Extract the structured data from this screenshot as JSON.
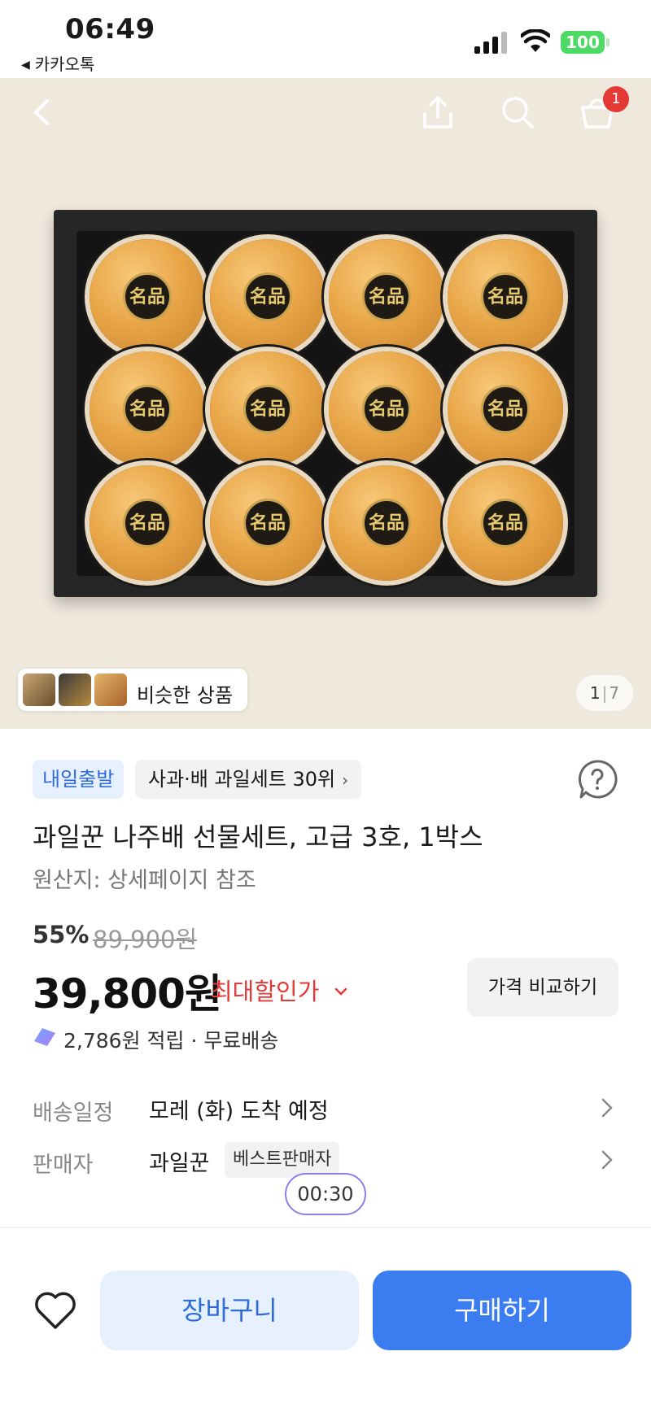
{
  "status_bar": {
    "time": "06:49",
    "back_app": "카카오톡",
    "battery": "100"
  },
  "header": {
    "cart_count": "1",
    "icons": [
      "back-arrow-icon",
      "share-icon",
      "search-icon",
      "cart-icon"
    ]
  },
  "hero": {
    "similar_label": "비슷한 상품",
    "pager_current": "1",
    "pager_sep": "|",
    "pager_total": "7",
    "seal_text": "名品"
  },
  "product": {
    "delivery_tag": "내일출발",
    "rank_tag": "사과·배 과일세트 30위",
    "rank_chevron": "›",
    "title": "과일꾼 나주배 선물세트, 고급 3호, 1박스",
    "origin": "원산지: 상세페이지 참조"
  },
  "pricing": {
    "discount_rate": "55%",
    "original_price": "89,900원",
    "price": "39,800원",
    "max_discount_label": "최대할인가",
    "compare_button": "가격 비교하기",
    "reward_text": "2,786원 적립 · 무료배송"
  },
  "info_rows": [
    {
      "label": "배송일정",
      "value": "모레 (화) 도착 예정"
    },
    {
      "label": "판매자",
      "value": "과일꾼",
      "badge": "베스트판매자"
    }
  ],
  "timer": "00:30",
  "bottom_bar": {
    "cart_button": "장바구니",
    "buy_button": "구매하기"
  },
  "colors": {
    "accent_blue": "#3b7cf0",
    "light_blue": "#e7f0ff",
    "discount_red": "#e53935",
    "battery_green": "#4cd964"
  }
}
